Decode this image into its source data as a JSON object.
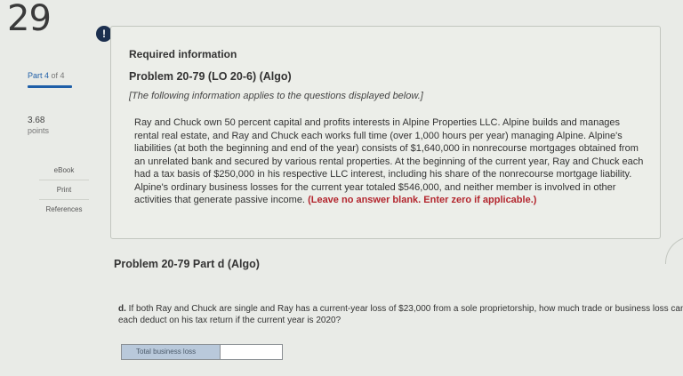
{
  "sidebar": {
    "question_number": "29",
    "part": "Part 4",
    "part_of": "of 4",
    "points_value": "3.68",
    "points_label": "points",
    "links": [
      "eBook",
      "Print",
      "References"
    ]
  },
  "alert_badge": "!",
  "info_panel": {
    "required": "Required information",
    "title": "Problem 20-79 (LO 20-6) (Algo)",
    "note": "[The following information applies to the questions displayed below.]",
    "body": "Ray and Chuck own 50 percent capital and profits interests in Alpine Properties LLC. Alpine builds and manages rental real estate, and Ray and Chuck each works full time (over 1,000 hours per year) managing Alpine. Alpine's liabilities (at both the beginning and end of the year) consists of $1,640,000 in nonrecourse mortgages obtained from an unrelated bank and secured by various rental properties. At the beginning of the current year, Ray and Chuck each had a tax basis of $250,000 in his respective LLC interest, including his share of the nonrecourse mortgage liability. Alpine's ordinary business losses for the current year totaled $546,000, and neither member is involved in other activities that generate passive income.",
    "warning": "(Leave no answer blank. Enter zero if applicable.)"
  },
  "part_title": "Problem 20-79 Part d (Algo)",
  "question": {
    "letter": "d.",
    "text": "If both Ray and Chuck are single and Ray has a current-year loss of $23,000 from a sole proprietorship, how much trade or business loss can each deduct on his tax return if the current year is 2020?"
  },
  "answer": {
    "label": "Total business loss",
    "value": ""
  },
  "colors": {
    "link_blue": "#1f5fa8",
    "warning_red": "#b3262e",
    "badge_navy": "#1c2f4f",
    "answer_label_bg": "#b9c9db"
  }
}
